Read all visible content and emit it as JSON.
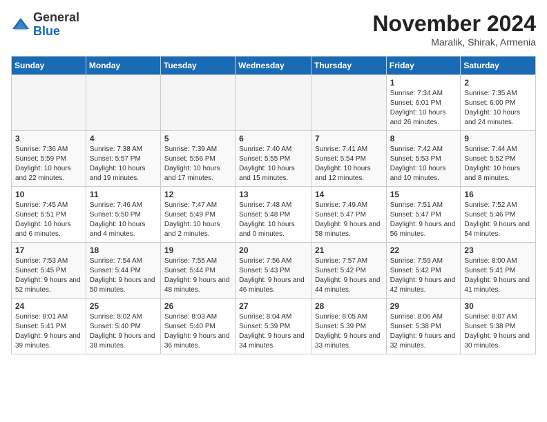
{
  "header": {
    "logo": {
      "general": "General",
      "blue": "Blue"
    },
    "title": "November 2024",
    "location": "Maralik, Shirak, Armenia"
  },
  "days_of_week": [
    "Sunday",
    "Monday",
    "Tuesday",
    "Wednesday",
    "Thursday",
    "Friday",
    "Saturday"
  ],
  "weeks": [
    [
      {
        "day": "",
        "info": ""
      },
      {
        "day": "",
        "info": ""
      },
      {
        "day": "",
        "info": ""
      },
      {
        "day": "",
        "info": ""
      },
      {
        "day": "",
        "info": ""
      },
      {
        "day": "1",
        "info": "Sunrise: 7:34 AM\nSunset: 6:01 PM\nDaylight: 10 hours and 26 minutes."
      },
      {
        "day": "2",
        "info": "Sunrise: 7:35 AM\nSunset: 6:00 PM\nDaylight: 10 hours and 24 minutes."
      }
    ],
    [
      {
        "day": "3",
        "info": "Sunrise: 7:36 AM\nSunset: 5:59 PM\nDaylight: 10 hours and 22 minutes."
      },
      {
        "day": "4",
        "info": "Sunrise: 7:38 AM\nSunset: 5:57 PM\nDaylight: 10 hours and 19 minutes."
      },
      {
        "day": "5",
        "info": "Sunrise: 7:39 AM\nSunset: 5:56 PM\nDaylight: 10 hours and 17 minutes."
      },
      {
        "day": "6",
        "info": "Sunrise: 7:40 AM\nSunset: 5:55 PM\nDaylight: 10 hours and 15 minutes."
      },
      {
        "day": "7",
        "info": "Sunrise: 7:41 AM\nSunset: 5:54 PM\nDaylight: 10 hours and 12 minutes."
      },
      {
        "day": "8",
        "info": "Sunrise: 7:42 AM\nSunset: 5:53 PM\nDaylight: 10 hours and 10 minutes."
      },
      {
        "day": "9",
        "info": "Sunrise: 7:44 AM\nSunset: 5:52 PM\nDaylight: 10 hours and 8 minutes."
      }
    ],
    [
      {
        "day": "10",
        "info": "Sunrise: 7:45 AM\nSunset: 5:51 PM\nDaylight: 10 hours and 6 minutes."
      },
      {
        "day": "11",
        "info": "Sunrise: 7:46 AM\nSunset: 5:50 PM\nDaylight: 10 hours and 4 minutes."
      },
      {
        "day": "12",
        "info": "Sunrise: 7:47 AM\nSunset: 5:49 PM\nDaylight: 10 hours and 2 minutes."
      },
      {
        "day": "13",
        "info": "Sunrise: 7:48 AM\nSunset: 5:48 PM\nDaylight: 10 hours and 0 minutes."
      },
      {
        "day": "14",
        "info": "Sunrise: 7:49 AM\nSunset: 5:47 PM\nDaylight: 9 hours and 58 minutes."
      },
      {
        "day": "15",
        "info": "Sunrise: 7:51 AM\nSunset: 5:47 PM\nDaylight: 9 hours and 56 minutes."
      },
      {
        "day": "16",
        "info": "Sunrise: 7:52 AM\nSunset: 5:46 PM\nDaylight: 9 hours and 54 minutes."
      }
    ],
    [
      {
        "day": "17",
        "info": "Sunrise: 7:53 AM\nSunset: 5:45 PM\nDaylight: 9 hours and 52 minutes."
      },
      {
        "day": "18",
        "info": "Sunrise: 7:54 AM\nSunset: 5:44 PM\nDaylight: 9 hours and 50 minutes."
      },
      {
        "day": "19",
        "info": "Sunrise: 7:55 AM\nSunset: 5:44 PM\nDaylight: 9 hours and 48 minutes."
      },
      {
        "day": "20",
        "info": "Sunrise: 7:56 AM\nSunset: 5:43 PM\nDaylight: 9 hours and 46 minutes."
      },
      {
        "day": "21",
        "info": "Sunrise: 7:57 AM\nSunset: 5:42 PM\nDaylight: 9 hours and 44 minutes."
      },
      {
        "day": "22",
        "info": "Sunrise: 7:59 AM\nSunset: 5:42 PM\nDaylight: 9 hours and 42 minutes."
      },
      {
        "day": "23",
        "info": "Sunrise: 8:00 AM\nSunset: 5:41 PM\nDaylight: 9 hours and 41 minutes."
      }
    ],
    [
      {
        "day": "24",
        "info": "Sunrise: 8:01 AM\nSunset: 5:41 PM\nDaylight: 9 hours and 39 minutes."
      },
      {
        "day": "25",
        "info": "Sunrise: 8:02 AM\nSunset: 5:40 PM\nDaylight: 9 hours and 38 minutes."
      },
      {
        "day": "26",
        "info": "Sunrise: 8:03 AM\nSunset: 5:40 PM\nDaylight: 9 hours and 36 minutes."
      },
      {
        "day": "27",
        "info": "Sunrise: 8:04 AM\nSunset: 5:39 PM\nDaylight: 9 hours and 34 minutes."
      },
      {
        "day": "28",
        "info": "Sunrise: 8:05 AM\nSunset: 5:39 PM\nDaylight: 9 hours and 33 minutes."
      },
      {
        "day": "29",
        "info": "Sunrise: 8:06 AM\nSunset: 5:38 PM\nDaylight: 9 hours and 32 minutes."
      },
      {
        "day": "30",
        "info": "Sunrise: 8:07 AM\nSunset: 5:38 PM\nDaylight: 9 hours and 30 minutes."
      }
    ]
  ]
}
